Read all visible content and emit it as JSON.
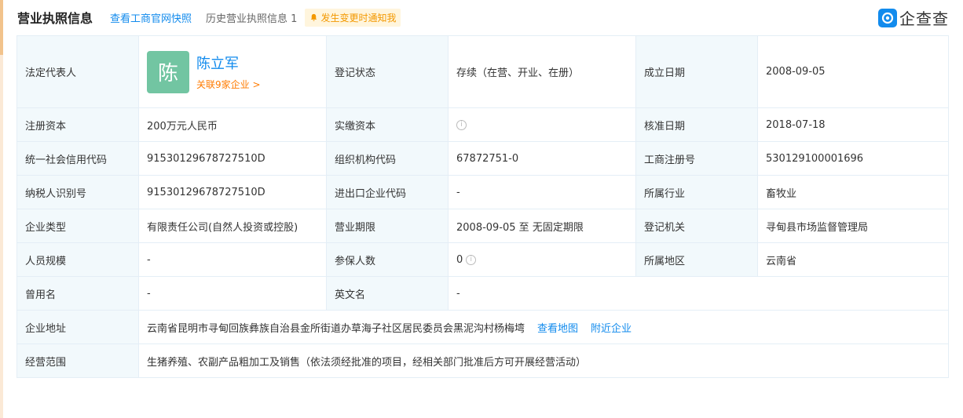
{
  "header": {
    "title": "营业执照信息",
    "snapshot_link": "查看工商官网快照",
    "history": "历史营业执照信息 1",
    "notify": "发生变更时通知我",
    "brand": "企查查"
  },
  "rows": {
    "legal_rep": {
      "label": "法定代表人",
      "avatar": "陈",
      "name": "陈立军",
      "related": "关联9家企业 >"
    },
    "reg_status": {
      "label": "登记状态",
      "value": "存续（在营、开业、在册）"
    },
    "est_date": {
      "label": "成立日期",
      "value": "2008-09-05"
    },
    "reg_capital": {
      "label": "注册资本",
      "value": "200万元人民币"
    },
    "paid_capital": {
      "label": "实缴资本",
      "value": ""
    },
    "approve_date": {
      "label": "核准日期",
      "value": "2018-07-18"
    },
    "credit_code": {
      "label": "统一社会信用代码",
      "value": "91530129678727510D"
    },
    "org_code": {
      "label": "组织机构代码",
      "value": "67872751-0"
    },
    "reg_number": {
      "label": "工商注册号",
      "value": "530129100001696"
    },
    "taxpayer_id": {
      "label": "纳税人识别号",
      "value": "91530129678727510D"
    },
    "import_export": {
      "label": "进出口企业代码",
      "value": "-"
    },
    "industry": {
      "label": "所属行业",
      "value": "畜牧业"
    },
    "company_type": {
      "label": "企业类型",
      "value": "有限责任公司(自然人投资或控股)"
    },
    "term": {
      "label": "营业期限",
      "value": "2008-09-05 至 无固定期限"
    },
    "authority": {
      "label": "登记机关",
      "value": "寻甸县市场监督管理局"
    },
    "staff_size": {
      "label": "人员规模",
      "value": "-"
    },
    "insured": {
      "label": "参保人数",
      "value": "0"
    },
    "region": {
      "label": "所属地区",
      "value": "云南省"
    },
    "former_name": {
      "label": "曾用名",
      "value": "-"
    },
    "english_name": {
      "label": "英文名",
      "value": "-"
    },
    "address": {
      "label": "企业地址",
      "value": "云南省昆明市寻甸回族彝族自治县金所街道办草海子社区居民委员会黑泥沟村杨梅塆",
      "map_link": "查看地图",
      "nearby_link": "附近企业"
    },
    "scope": {
      "label": "经营范围",
      "value": "生猪养殖、农副产品粗加工及销售（依法须经批准的项目，经相关部门批准后方可开展经营活动）"
    }
  },
  "colors": {
    "accent": "#128bed",
    "orange": "#ff7b00",
    "label_bg": "#f2f9fc",
    "avatar_bg": "#72c5a2"
  }
}
